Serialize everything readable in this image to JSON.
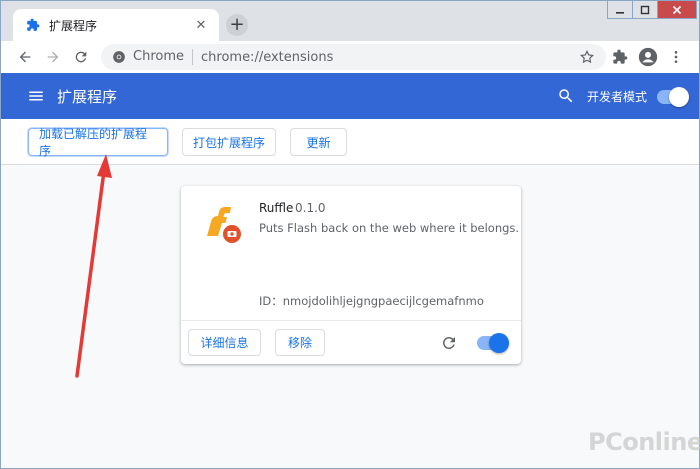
{
  "browser": {
    "tab": {
      "title": "扩展程序",
      "close_glyph": "✕",
      "favicon": "puzzle-icon"
    },
    "new_tab_glyph": "+",
    "window_controls": [
      "minimize-icon",
      "maximize-icon",
      "close-icon"
    ],
    "omnibox": {
      "chip": "Chrome",
      "url": "chrome://extensions",
      "site_icon": "chrome-info-icon",
      "star_icon": "star-icon"
    },
    "toolbar_icons": [
      "back-icon",
      "forward-icon",
      "reload-icon",
      "puzzle-icon",
      "profile-icon",
      "kebab-menu-icon"
    ]
  },
  "header": {
    "title": "扩展程序",
    "dev_mode_label": "开发者模式",
    "dev_mode_on": true
  },
  "actions": {
    "load_unpacked": "加载已解压的扩展程序",
    "pack": "打包扩展程序",
    "update": "更新"
  },
  "extension": {
    "name": "Ruffle",
    "version": "0.1.0",
    "description": "Puts Flash back on the web where it belongs.",
    "id_line": "ID：nmojdolihljejgngpaecijlcgemafnmo",
    "details_label": "详细信息",
    "remove_label": "移除",
    "enabled": true
  },
  "watermark": "PConline",
  "colors": {
    "accent": "#3367d6",
    "link": "#1a73e8",
    "toggle_track": "#8ab4f8",
    "toggle_knob": "#1a73e8",
    "arrow": "#e53935"
  }
}
